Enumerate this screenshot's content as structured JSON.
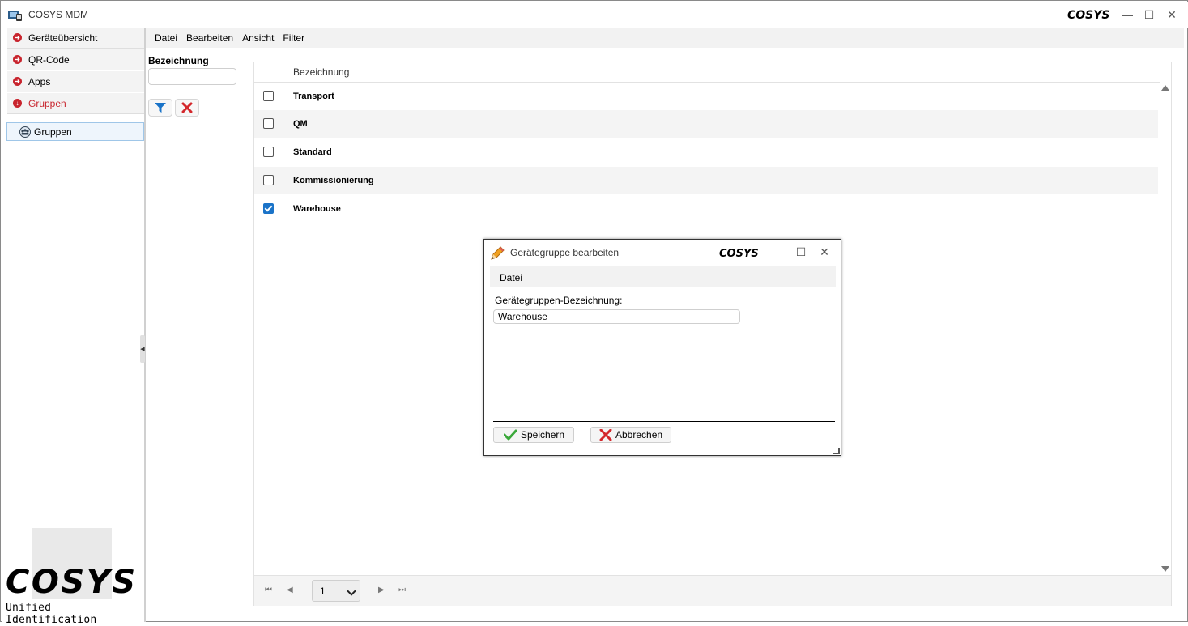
{
  "window": {
    "title": "COSYS MDM",
    "logo_text": "COSYS",
    "controls": [
      "minimize",
      "maximize",
      "close"
    ]
  },
  "sidebar": {
    "items": [
      {
        "label": "Geräteübersicht",
        "icon": "arrow-right-circle-icon",
        "active": false
      },
      {
        "label": "QR-Code",
        "icon": "arrow-right-circle-icon",
        "active": false
      },
      {
        "label": "Apps",
        "icon": "arrow-right-circle-icon",
        "active": false
      },
      {
        "label": "Gruppen",
        "icon": "arrow-down-circle-icon",
        "active": true
      }
    ],
    "tree": {
      "label": "Gruppen",
      "icon": "group-icon"
    },
    "logo_text": "COSYS",
    "slogan": "Unified Identification"
  },
  "menubar": {
    "items": [
      "Datei",
      "Bearbeiten",
      "Ansicht",
      "Filter"
    ]
  },
  "filter": {
    "label": "Bezeichnung",
    "value": "",
    "apply_icon": "filter-icon",
    "clear_icon": "clear-x-icon"
  },
  "grid": {
    "header": "Bezeichnung",
    "rows": [
      {
        "label": "Transport",
        "checked": false
      },
      {
        "label": "QM",
        "checked": false
      },
      {
        "label": "Standard",
        "checked": false
      },
      {
        "label": "Kommissionierung",
        "checked": false
      },
      {
        "label": "Warehouse",
        "checked": true
      }
    ],
    "pager": {
      "page": "1"
    }
  },
  "dialog": {
    "title": "Gerätegruppe bearbeiten",
    "logo_text": "COSYS",
    "menu": [
      "Datei"
    ],
    "field_label": "Gerätegruppen-Bezeichnung:",
    "field_value": "Warehouse",
    "save_label": "Speichern",
    "cancel_label": "Abbrechen"
  },
  "colors": {
    "accent_red": "#c8242d",
    "checkbox_blue": "#1a73c8",
    "filter_blue": "#1a73c8"
  }
}
